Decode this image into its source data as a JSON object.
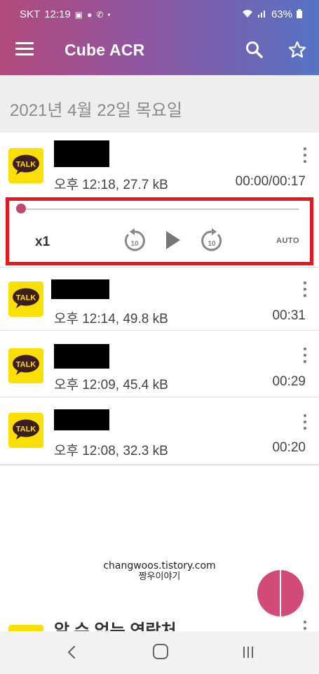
{
  "status_bar": {
    "carrier": "SKT",
    "time": "12:19",
    "battery": "63%"
  },
  "app": {
    "title": "Cube ACR"
  },
  "date_header": "2021년 4월 22일 목요일",
  "recordings": [
    {
      "app_icon": "kakaotalk-icon",
      "icon_label": "TALK",
      "meta": "오후 12:18, 27.7 kB",
      "duration": "00:00/00:17",
      "contact_redacted": true
    },
    {
      "app_icon": "kakaotalk-icon",
      "icon_label": "TALK",
      "meta": "오후 12:14, 49.8 kB",
      "duration": "00:31",
      "contact_redacted": true
    },
    {
      "app_icon": "kakaotalk-icon",
      "icon_label": "TALK",
      "meta": "오후 12:09, 45.4 kB",
      "duration": "00:29",
      "contact_redacted": true
    },
    {
      "app_icon": "kakaotalk-icon",
      "icon_label": "TALK",
      "meta": "오후 12:08, 32.3 kB",
      "duration": "00:20",
      "contact_redacted": true
    }
  ],
  "player": {
    "speed": "x1",
    "rewind_label": "10",
    "forward_label": "10",
    "auto_label": "AUTO",
    "progress": 0.0,
    "highlight_color": "#e8161e"
  },
  "watermark": {
    "line1": "changwoos.tistory.com",
    "line2": "짱우이야기"
  },
  "partial_item": {
    "title": "알 수 없는 연락처"
  },
  "colors": {
    "accent": "#c2486f",
    "header_start": "#b34a7c",
    "header_end": "#5672c4",
    "kakao_yellow": "#f9e000"
  }
}
